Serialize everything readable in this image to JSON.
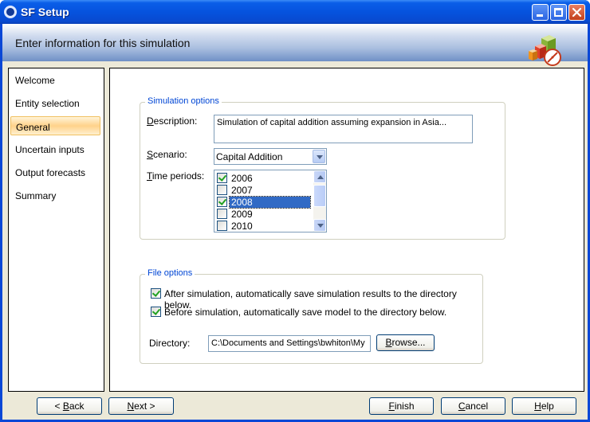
{
  "window": {
    "title": "SF Setup"
  },
  "banner": {
    "text": "Enter information for this simulation"
  },
  "nav": {
    "items": [
      {
        "label": "Welcome",
        "selected": false
      },
      {
        "label": "Entity selection",
        "selected": false
      },
      {
        "label": "General",
        "selected": true
      },
      {
        "label": "Uncertain inputs",
        "selected": false
      },
      {
        "label": "Output forecasts",
        "selected": false
      },
      {
        "label": "Summary",
        "selected": false
      }
    ]
  },
  "simulation_options": {
    "legend": "Simulation options",
    "description_label_accel": "D",
    "description_label_rest": "escription:",
    "description_value": "Simulation of capital addition assuming expansion in Asia...",
    "scenario_label_accel": "S",
    "scenario_label_rest": "cenario:",
    "scenario_value": "Capital Addition",
    "time_periods_label_accel": "T",
    "time_periods_label_rest": "ime periods:",
    "time_periods": [
      {
        "label": "2006",
        "checked": true,
        "selected": false
      },
      {
        "label": "2007",
        "checked": false,
        "selected": false
      },
      {
        "label": "2008",
        "checked": true,
        "selected": true
      },
      {
        "label": "2009",
        "checked": false,
        "selected": false
      },
      {
        "label": "2010",
        "checked": false,
        "selected": false
      }
    ]
  },
  "file_options": {
    "legend": "File options",
    "after_sim_label": "After simulation, automatically save simulation results to the directory below.",
    "after_sim_checked": true,
    "before_sim_label": "Before simulation, automatically save model to the directory below.",
    "before_sim_checked": true,
    "directory_label": "Directory:",
    "directory_value": "C:\\Documents and Settings\\bwhiton\\My",
    "browse_accel": "B",
    "browse_rest": "rowse..."
  },
  "buttons": {
    "back_prefix": "< ",
    "back_accel": "B",
    "back_rest": "ack",
    "next_accel": "N",
    "next_rest": "ext >",
    "finish_accel": "F",
    "finish_rest": "inish",
    "cancel_accel": "C",
    "cancel_rest": "ancel",
    "help_accel": "H",
    "help_rest": "elp"
  },
  "colors": {
    "title_bar": "#0653de",
    "group_legend": "#0046d5",
    "selection": "#316ac5",
    "nav_selected": "#ffd28a",
    "checkmark": "#21a121"
  },
  "icons": {
    "app": "app-circle-icon",
    "logo": "blocks-compass-logo"
  }
}
